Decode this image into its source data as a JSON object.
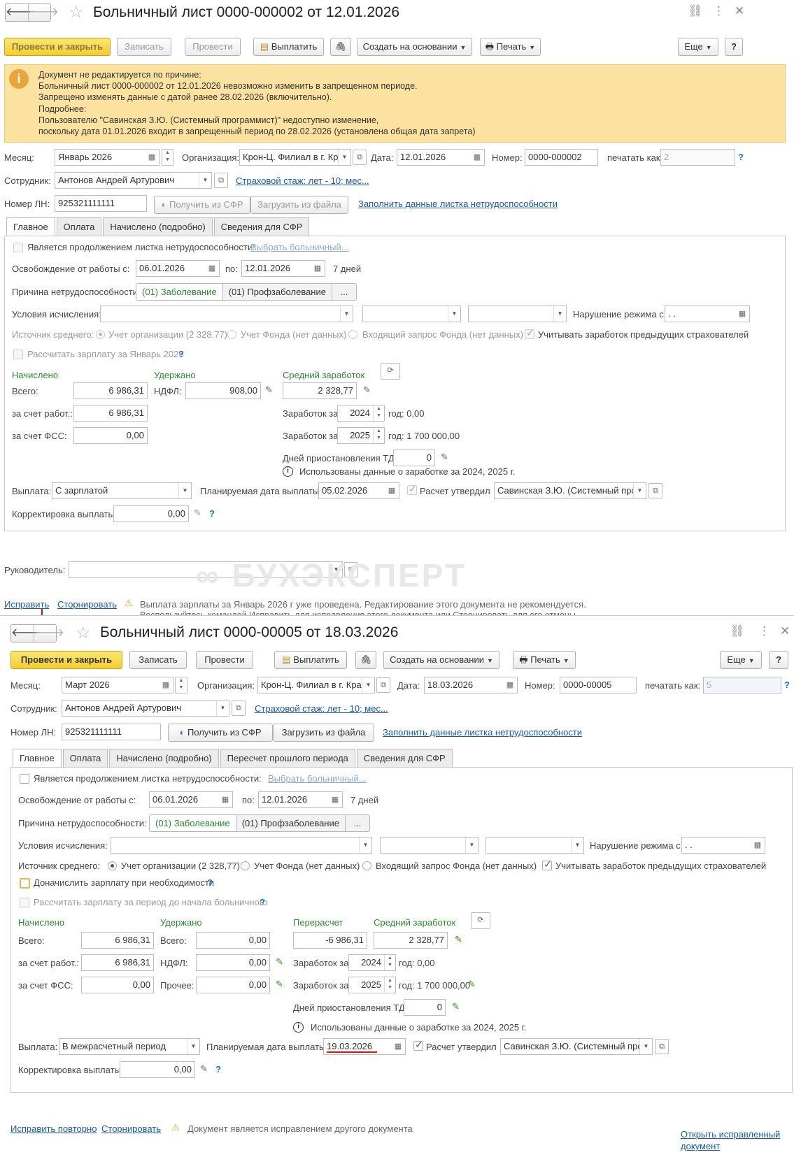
{
  "doc1": {
    "title": "Больничный лист 0000-000002 от 12.01.2026",
    "toolbar": {
      "post_close": "Провести и закрыть",
      "save": "Записать",
      "post": "Провести",
      "pay": "Выплатить",
      "create_based": "Создать на основании",
      "print": "Печать",
      "more": "Еще",
      "help": "?"
    },
    "warning_lines": [
      "Документ не редактируется по причине:",
      "Больничный лист 0000-000002 от 12.01.2026 невозможно изменить в запрещенном периоде.",
      "Запрещено изменять данные с датой ранее 28.02.2026 (включительно).",
      "Подробнее:",
      "Пользователю \"Савинская З.Ю. (Системный программист)\" недоступно изменение,",
      "поскольку дата 01.01.2026 входит в запрещенный период по 28.02.2026 (установлена общая дата запрета)"
    ],
    "header": {
      "month_label": "Месяц:",
      "month": "Январь 2026",
      "org_label": "Организация:",
      "org": "Крон-Ц. Филиал в г. Кра",
      "date_label": "Дата:",
      "date": "12.01.2026",
      "number_label": "Номер:",
      "number": "0000-000002",
      "print_as_label": "печатать как:",
      "print_as": "2",
      "employee_label": "Сотрудник:",
      "employee": "Антонов Андрей Артурович",
      "insurance_link": "Страховой стаж: лет - 10; мес...",
      "ln_label": "Номер ЛН:",
      "ln": "925321111111",
      "get_sfr": "Получить из СФР",
      "load_file": "Загрузить из файла",
      "fill_link": "Заполнить данные листка нетрудоспособности"
    },
    "tabs": [
      "Главное",
      "Оплата",
      "Начислено (подробно)",
      "Сведения для СФР"
    ],
    "main": {
      "continuation": "Является продолжением листка нетрудоспособности:",
      "choose_sick": "Выбрать больничный...",
      "release_label": "Освобождение от работы с:",
      "release_from": "06.01.2026",
      "to_label": "по:",
      "release_to": "12.01.2026",
      "days": "7 дней",
      "reason_label": "Причина нетрудоспособности:",
      "reason_1": "(01) Заболевание",
      "reason_2": "(01) Профзаболевание",
      "reason_more": "...",
      "conditions_label": "Условия исчисления:",
      "violation_label": "Нарушение режима с:",
      "violation": ". .",
      "avg_source_label": "Источник среднего:",
      "src_org": "Учет организации (2 328,77)",
      "src_fund": "Учет Фонда (нет данных)",
      "src_request": "Входящий запрос Фонда (нет данных)",
      "consider_prev": "Учитывать заработок предыдущих страхователей",
      "calc_salary": "Рассчитать зарплату за Январь 2026",
      "accrued_label": "Начислено",
      "total_label": "Всего:",
      "total": "6 986,31",
      "employer_label": "за счет работ.:",
      "employer": "6 986,31",
      "fss_label": "за счет ФСС:",
      "fss": "0,00",
      "withheld_label": "Удержано",
      "ndfl_label": "НДФЛ:",
      "ndfl": "908,00",
      "avg_label": "Средний заработок",
      "avg": "2 328,77",
      "earn_label": "Заработок за",
      "year1": "2024",
      "year1_val": "год: 0,00",
      "year2": "2025",
      "year2_val": "год: 1 700 000,00",
      "suspend_label": "Дней приостановления ТД:",
      "suspend": "0",
      "used_info": "Использованы данные о заработке за  2024,  2025 г.",
      "payout_label": "Выплата:",
      "payout": "С зарплатой",
      "planned_label": "Планируемая дата выплаты:",
      "planned": "05.02.2026",
      "approved_label": "Расчет утвердил",
      "approver": "Савинская З.Ю. (Системный прогр",
      "correction_label": "Корректировка выплаты:",
      "correction": "0,00"
    },
    "manager_label": "Руководитель:",
    "footer": {
      "fix": "Исправить",
      "reverse": "Сторнировать",
      "note_1": "Выплата зарплаты за Январь 2026 г уже проведена. Редактирование этого документа не рекомендуется.",
      "note_2": "Воспользуйтесь командой Исправить для исправления этого документа или Сторнировать для его отмены"
    }
  },
  "watermark": "БУХЭКСПЕРТ",
  "doc2": {
    "title": "Больничный лист 0000-00005 от 18.03.2026",
    "toolbar": {
      "post_close": "Провести и закрыть",
      "save": "Записать",
      "post": "Провести",
      "pay": "Выплатить",
      "create_based": "Создать на основании",
      "print": "Печать",
      "more": "Еще",
      "help": "?"
    },
    "header": {
      "month_label": "Месяц:",
      "month": "Март 2026",
      "org_label": "Организация:",
      "org": "Крон-Ц. Филиал в г. Кра",
      "date_label": "Дата:",
      "date": "18.03.2026",
      "number_label": "Номер:",
      "number": "0000-00005",
      "print_as_label": "печатать как:",
      "print_as": "5",
      "employee_label": "Сотрудник:",
      "employee": "Антонов Андрей Артурович",
      "insurance_link": "Страховой стаж: лет - 10; мес...",
      "ln_label": "Номер ЛН:",
      "ln": "925321111111",
      "get_sfr": "Получить из СФР",
      "load_file": "Загрузить из файла",
      "fill_link": "Заполнить данные листка нетрудоспособности"
    },
    "tabs": [
      "Главное",
      "Оплата",
      "Начислено (подробно)",
      "Пересчет прошлого периода",
      "Сведения для СФР"
    ],
    "main": {
      "continuation": "Является продолжением листка нетрудоспособности:",
      "choose_sick": "Выбрать больничный...",
      "release_label": "Освобождение от работы с:",
      "release_from": "06.01.2026",
      "to_label": "по:",
      "release_to": "12.01.2026",
      "days": "7 дней",
      "reason_label": "Причина нетрудоспособности:",
      "reason_1": "(01) Заболевание",
      "reason_2": "(01) Профзаболевание",
      "reason_more": "...",
      "conditions_label": "Условия исчисления:",
      "violation_label": "Нарушение режима с:",
      "violation": ". .",
      "avg_source_label": "Источник среднего:",
      "src_org": "Учет организации (2 328,77)",
      "src_fund": "Учет Фонда (нет данных)",
      "src_request": "Входящий запрос Фонда (нет данных)",
      "consider_prev": "Учитывать заработок предыдущих страхователей",
      "add_salary": "Доначислить зарплату при необходимости",
      "calc_salary": "Рассчитать зарплату за период до начала больничного",
      "accrued_label": "Начислено",
      "total_label": "Всего:",
      "total": "6 986,31",
      "employer_label": "за счет работ.:",
      "employer": "6 986,31",
      "fss_label": "за счет ФСС:",
      "fss": "0,00",
      "withheld_label": "Удержано",
      "w_total_label": "Всего:",
      "w_total": "0,00",
      "ndfl_label": "НДФЛ:",
      "ndfl": "0,00",
      "other_label": "Прочее:",
      "other": "0,00",
      "recalc_label": "Перерасчет",
      "recalc": "-6 986,31",
      "avg_label": "Средний заработок",
      "avg": "2 328,77",
      "earn_label": "Заработок за",
      "year1": "2024",
      "year1_val": "год: 0,00",
      "year2": "2025",
      "year2_val": "год: 1 700 000,00",
      "suspend_label": "Дней приостановления ТД:",
      "suspend": "0",
      "used_info": "Использованы данные о заработке за  2024,  2025 г.",
      "payout_label": "Выплата:",
      "payout": "В межрасчетный период",
      "planned_label": "Планируемая дата выплаты:",
      "planned": "19.03.2026",
      "approved_label": "Расчет утвердил",
      "approver": "Савинская З.Ю. (Системный прогр",
      "correction_label": "Корректировка выплаты:",
      "correction": "0,00"
    },
    "footer": {
      "fix_again": "Исправить повторно",
      "reverse": "Сторнировать",
      "note": "Документ является исправлением другого документа",
      "open_fixed_1": "Открыть исправленный",
      "open_fixed_2": "документ"
    }
  },
  "colors": {
    "accent_yellow": "#f5d23a",
    "warning_bg": "#fce2a0",
    "link": "#1558b5",
    "green_label": "#2e8a2e",
    "annotation_red": "#e01010"
  }
}
